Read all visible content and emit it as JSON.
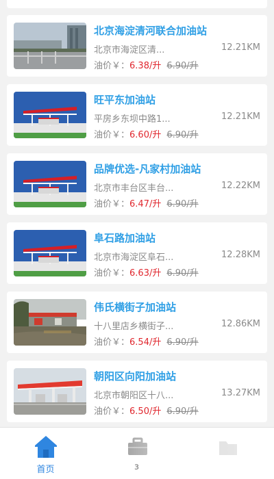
{
  "colors": {
    "accent": "#2f9fe5",
    "price_red": "#e0262d",
    "muted": "#8a8a8a",
    "tab_active": "#2f86e0",
    "background": "#f2f2f2"
  },
  "stations": [
    {
      "name": "北京海淀清河联合加油站",
      "address": "北京市海淀区清...",
      "distance": "12.21KM",
      "price_label": "油价￥：",
      "price": "6.38/升",
      "original_price": "6.90/升",
      "thumb_icon": "street-photo"
    },
    {
      "name": "旺平东加油站",
      "address": "平房乡东坝中路1...",
      "distance": "12.21KM",
      "price_label": "油价￥：",
      "price": "6.60/升",
      "original_price": "6.90/升",
      "thumb_icon": "canopy-rendering"
    },
    {
      "name": "品牌优选-凡家村加油站",
      "address": "北京市丰台区丰台...",
      "distance": "12.22KM",
      "price_label": "油价￥：",
      "price": "6.47/升",
      "original_price": "6.90/升",
      "thumb_icon": "canopy-rendering"
    },
    {
      "name": "阜石路加油站",
      "address": "北京市海淀区阜石...",
      "distance": "12.28KM",
      "price_label": "油价￥：",
      "price": "6.63/升",
      "original_price": "6.90/升",
      "thumb_icon": "canopy-rendering"
    },
    {
      "name": "伟氏横街子加油站",
      "address": "十八里店乡横街子...",
      "distance": "12.86KM",
      "price_label": "油价￥：",
      "price": "6.54/升",
      "original_price": "6.90/升",
      "thumb_icon": "rainy-station-photo"
    },
    {
      "name": "朝阳区向阳加油站",
      "address": "北京市朝阳区十八...",
      "distance": "13.27KM",
      "price_label": "油价￥：",
      "price": "6.50/升",
      "original_price": "6.90/升",
      "thumb_icon": "station-canopy-photo"
    }
  ],
  "tabbar": {
    "home": {
      "label": "首页",
      "icon": "home-icon"
    },
    "second": {
      "label": "з",
      "icon": "briefcase-icon"
    },
    "third": {
      "label": "",
      "icon": "folder-icon"
    }
  }
}
